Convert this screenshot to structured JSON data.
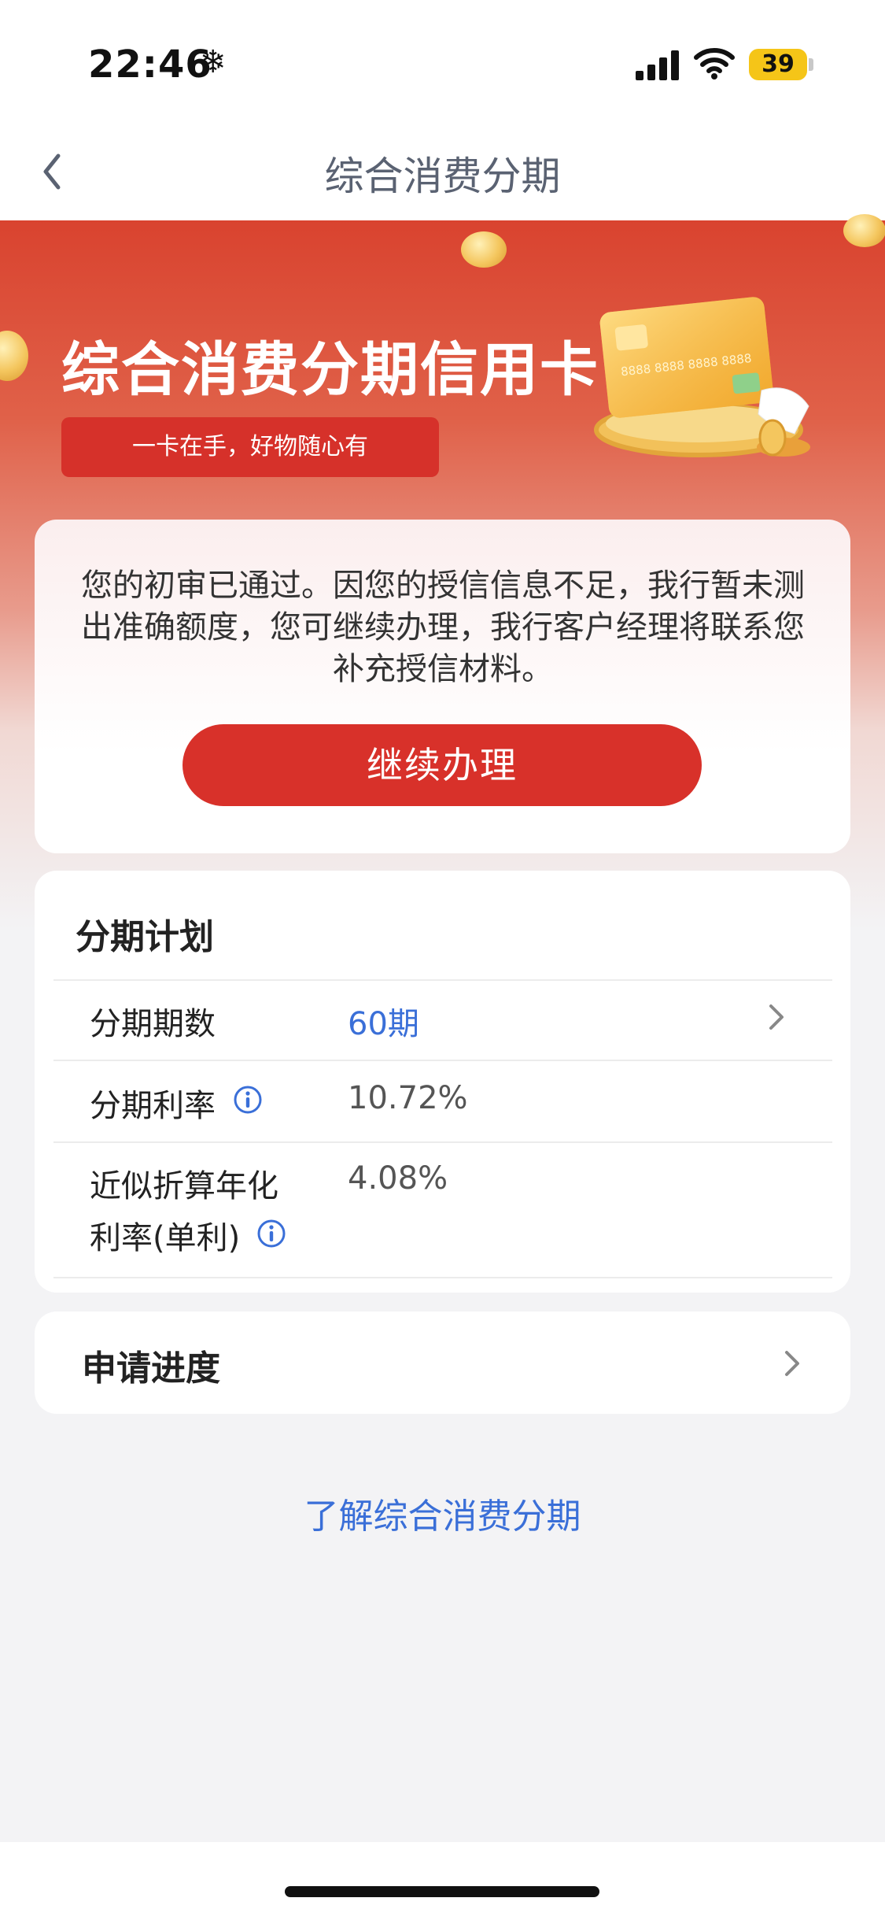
{
  "status": {
    "time": "22:46",
    "battery": "39"
  },
  "nav": {
    "title": "综合消费分期"
  },
  "hero": {
    "title": "综合消费分期信用卡",
    "slogan": "一卡在手，好物随心有"
  },
  "notice": {
    "message": "您的初审已通过。因您的授信信息不足，我行暂未测出准确额度，您可继续办理，我行客户经理将联系您补充授信材料。",
    "button_label": "继续办理"
  },
  "plan": {
    "title": "分期计划",
    "rows": [
      {
        "label": "分期期数",
        "value": "60期"
      },
      {
        "label": "分期利率",
        "value": "10.72%"
      },
      {
        "label_line1": "近似折算年化",
        "label_line2": "利率(单利)",
        "value": "4.08%"
      }
    ]
  },
  "progress": {
    "title": "申请进度"
  },
  "learn_more": "了解综合消费分期",
  "colors": {
    "primary_red": "#d8312a",
    "link_blue": "#3a6fd8"
  },
  "icons": [
    "snowflake-icon",
    "signal-icon",
    "wifi-icon",
    "battery-icon",
    "back-chevron-icon",
    "info-icon",
    "chevron-right-icon",
    "credit-card-illustration",
    "coin-icon"
  ]
}
